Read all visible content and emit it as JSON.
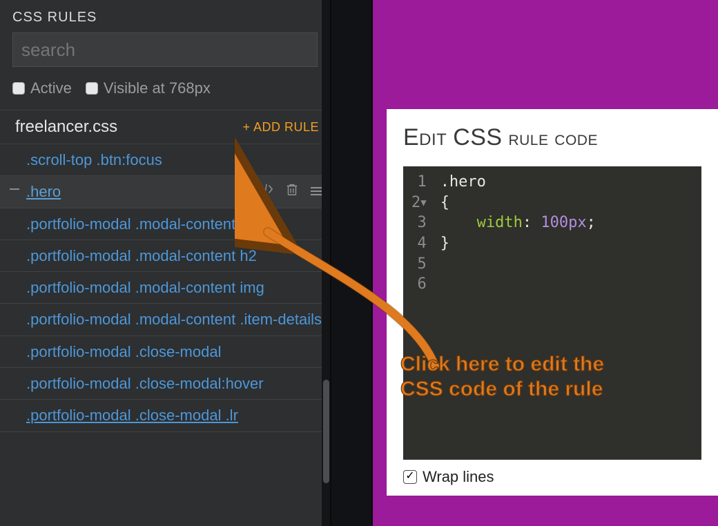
{
  "panel": {
    "title": "CSS RULES",
    "search_placeholder": "search",
    "filter_active": "Active",
    "filter_visible": "Visible at 768px"
  },
  "file": {
    "name": "freelancer.css",
    "add_rule_label": "+ ADD RULE"
  },
  "rules": [
    ".scroll-top .btn:focus",
    ".hero",
    ".portfolio-modal .modal-content",
    ".portfolio-modal .modal-content h2",
    ".portfolio-modal .modal-content img",
    ".portfolio-modal .modal-content .item-details",
    ".portfolio-modal .close-modal",
    ".portfolio-modal .close-modal:hover",
    ".portfolio-modal .close-modal .lr"
  ],
  "selected_rule_index": 1,
  "editor": {
    "title_word1": "Edit",
    "title_word2": "CSS",
    "title_rest": "rule code",
    "wrap_label": "Wrap lines",
    "code": {
      "selector": ".hero",
      "prop": "width",
      "value": "100px",
      "lines": [
        "1",
        "2",
        "3",
        "4",
        "5",
        "6"
      ]
    }
  },
  "annotation": {
    "text_line1": "Click here to edit the",
    "text_line2": "CSS code of the rule"
  },
  "colors": {
    "accent_orange": "#ee8a1f",
    "link_blue": "#4e97d8",
    "bg_purple": "#9b1b9b"
  }
}
